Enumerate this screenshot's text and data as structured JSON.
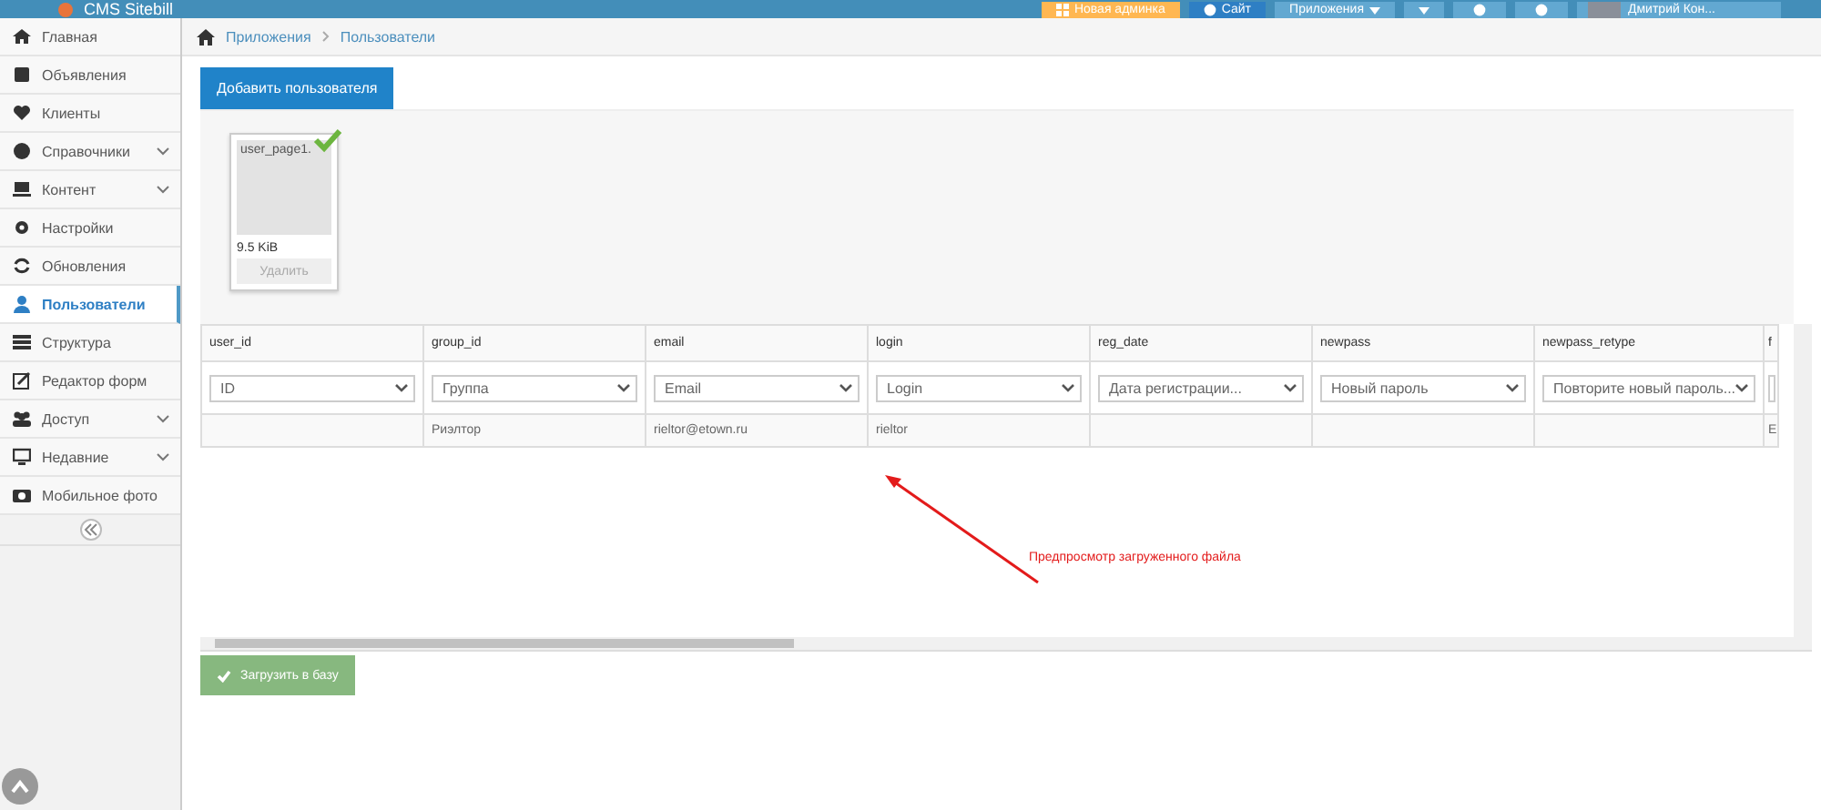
{
  "header": {
    "logo": "CMS Sitebill",
    "buttons": [
      {
        "kind": "orange",
        "label": "Новая админка"
      },
      {
        "kind": "dark",
        "label": "Сайт"
      },
      {
        "kind": "dropdown",
        "label": "Приложения"
      },
      {
        "kind": "dropdown"
      },
      {
        "kind": "icon"
      },
      {
        "kind": "icon"
      }
    ],
    "user": "Дмитрий Кон..."
  },
  "sidebar": {
    "items": [
      {
        "label": "Главная",
        "expandable": false,
        "selected": false
      },
      {
        "label": "Объявления",
        "expandable": false,
        "selected": false
      },
      {
        "label": "Клиенты",
        "expandable": false,
        "selected": false
      },
      {
        "label": "Справочники",
        "expandable": true,
        "selected": false
      },
      {
        "label": "Контент",
        "expandable": true,
        "selected": false
      },
      {
        "label": "Настройки",
        "expandable": false,
        "selected": false
      },
      {
        "label": "Обновления",
        "expandable": false,
        "selected": false
      },
      {
        "label": "Пользователи",
        "expandable": false,
        "selected": true
      },
      {
        "label": "Структура",
        "expandable": false,
        "selected": false
      },
      {
        "label": "Редактор форм",
        "expandable": false,
        "selected": false
      },
      {
        "label": "Доступ",
        "expandable": true,
        "selected": false
      },
      {
        "label": "Недавние",
        "expandable": true,
        "selected": false
      },
      {
        "label": "Мобильное фото",
        "expandable": false,
        "selected": false
      }
    ]
  },
  "breadcrumb": [
    "Приложения",
    "Пользователи"
  ],
  "add_button": "Добавить пользователя",
  "upload": {
    "filename": "user_page1.",
    "size": "9.5 KiB",
    "delete": "Удалить",
    "uploaded": true
  },
  "table": {
    "columns": [
      "user_id",
      "group_id",
      "email",
      "login",
      "reg_date",
      "newpass",
      "newpass_retype",
      "f"
    ],
    "filters": [
      "ID",
      "Группа",
      "Email",
      "Login",
      "Дата регистрации...",
      "Новый пароль",
      "Повторите новый пароль..."
    ],
    "rows": [
      [
        "",
        "Риэлтор",
        "rieltor@etown.ru",
        "rieltor",
        "",
        "",
        "",
        "Е"
      ]
    ]
  },
  "annotation": "Предпросмотр загруженного файла",
  "submit_button": "Загрузить в базу"
}
